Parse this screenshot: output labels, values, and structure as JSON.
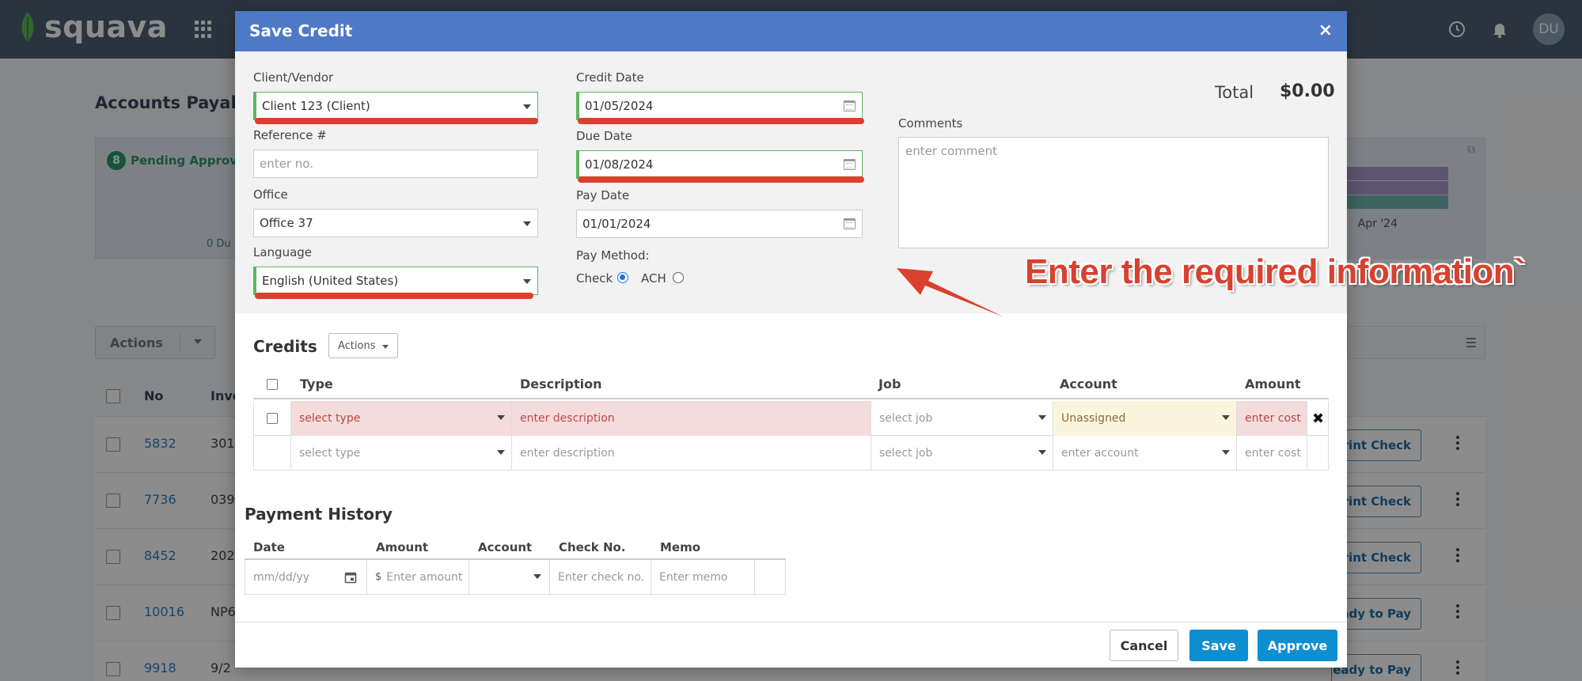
{
  "app": {
    "brand": "squava",
    "user_initials": "DU",
    "page_title": "Accounts Payable",
    "summary": {
      "pending_count": "8",
      "pending_label": "Pending Approva",
      "due_text": "0 Du",
      "month_label": "Apr '24"
    },
    "actions_label": "Actions",
    "table_headers": {
      "no": "No",
      "invoice": "Invo"
    },
    "rows": [
      {
        "no": "5832",
        "invoice": "301",
        "button": "Print Check"
      },
      {
        "no": "7736",
        "invoice": "039",
        "button": "Print Check"
      },
      {
        "no": "8452",
        "invoice": "202",
        "button": "Print Check"
      },
      {
        "no": "10016",
        "invoice": "NP6",
        "button": "Ready to Pay"
      },
      {
        "no": "9918",
        "invoice": "9/2",
        "button": "Ready to Pay"
      }
    ]
  },
  "modal": {
    "title": "Save Credit",
    "close_symbol": "×",
    "fields": {
      "client_vendor": {
        "label": "Client/Vendor",
        "value": "Client 123 (Client)"
      },
      "reference": {
        "label": "Reference #",
        "placeholder": "enter no."
      },
      "office": {
        "label": "Office",
        "value": "Office 37"
      },
      "language": {
        "label": "Language",
        "value": "English (United States)"
      },
      "credit_date": {
        "label": "Credit Date",
        "value": "01/05/2024"
      },
      "due_date": {
        "label": "Due Date",
        "value": "01/08/2024"
      },
      "pay_date": {
        "label": "Pay Date",
        "value": "01/01/2024"
      },
      "pay_method": {
        "label": "Pay Method:",
        "options": [
          "Check",
          "ACH"
        ],
        "selected": "Check"
      },
      "comments": {
        "label": "Comments",
        "placeholder": "enter comment"
      }
    },
    "total": {
      "label": "Total",
      "value": "$0.00"
    },
    "annotation": "Enter the required information`",
    "credits": {
      "title": "Credits",
      "actions_label": "Actions",
      "headers": [
        "Type",
        "Description",
        "Job",
        "Account",
        "Amount"
      ],
      "rows": [
        {
          "type": "select type",
          "description": "enter description",
          "job": "select job",
          "account": "Unassigned",
          "amount": "enter cost",
          "delete": "✖"
        },
        {
          "type": "select type",
          "description": "enter description",
          "job": "select job",
          "account": "enter account",
          "amount": "enter cost"
        }
      ]
    },
    "payment_history": {
      "title": "Payment History",
      "headers": [
        "Date",
        "Amount",
        "Account",
        "Check No.",
        "Memo"
      ],
      "row": {
        "date": "mm/dd/yy",
        "currency": "$",
        "amount": "Enter amount",
        "check_no": "Enter check no.",
        "memo": "Enter memo"
      }
    },
    "buttons": {
      "cancel": "Cancel",
      "save": "Save",
      "approve": "Approve"
    }
  },
  "colors": {
    "header": "#4e79c4",
    "required": "#2ea043",
    "annotation": "#d9412f",
    "primary_button": "#0e8fd1"
  }
}
